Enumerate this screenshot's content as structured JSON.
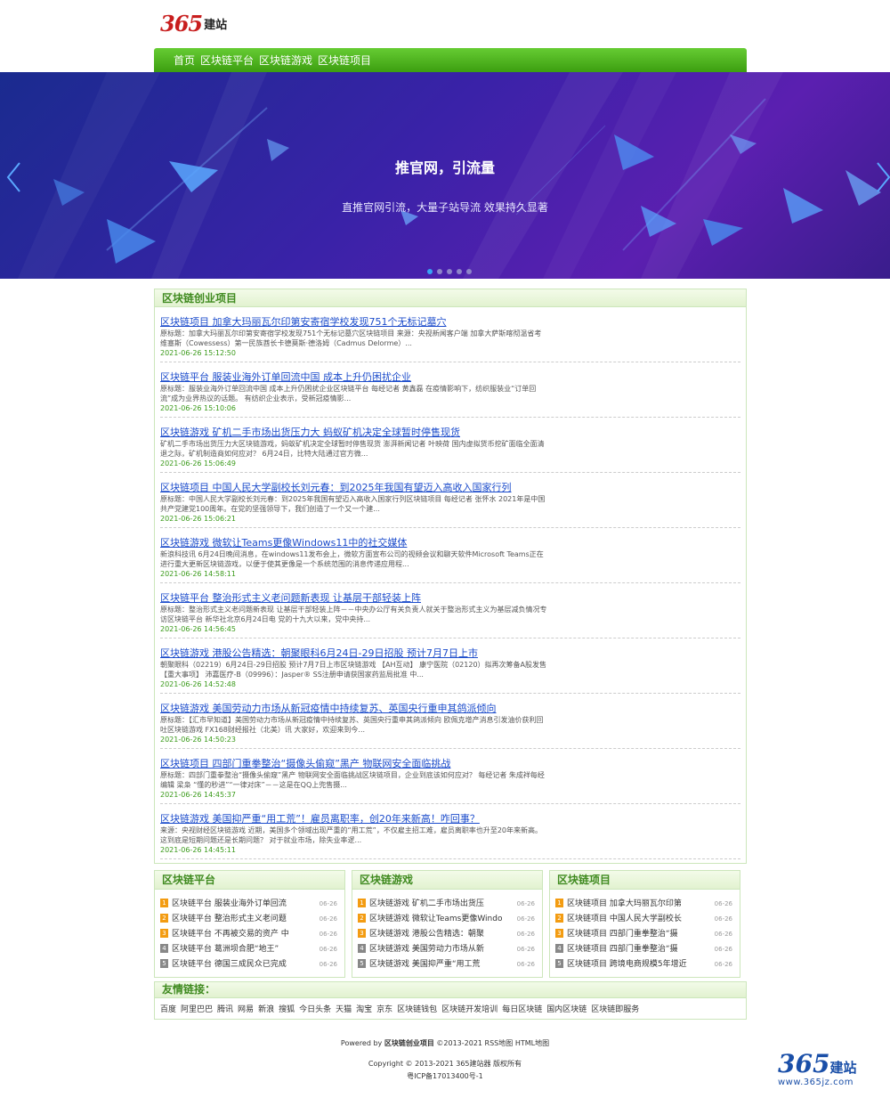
{
  "logo": {
    "number": "365",
    "text": "建站"
  },
  "nav": [
    "首页",
    "区块链平台",
    "区块链游戏",
    "区块链项目"
  ],
  "banner": {
    "title": "推官网，引流量",
    "subtitle": "直推官网引流，大量子站导流 效果持久显著",
    "slide_count": 5,
    "active_slide": 1
  },
  "main": {
    "heading": "区块链创业项目",
    "items": [
      {
        "title": "区块链项目 加拿大玛丽瓦尔印第安寄宿学校发现751个无标记墓穴",
        "desc": "原标题：加拿大玛丽瓦尔印第安寄宿学校发现751个无标记墓穴区块链项目 来源：央视新闻客户端 加拿大萨斯喀彻温省考维塞斯（Cowessess）第一民族酋长卡德莫斯·德洛姆（Cadmus Delorme）...",
        "time": "2021-06-26 15:12:50"
      },
      {
        "title": "区块链平台 服装业海外订单回流中国 成本上升仍困扰企业",
        "desc": "原标题：服装业海外订单回流中国 成本上升仍困扰企业区块链平台 每经记者 黄鑫磊 在疫情影响下，纺织服装业“订单回流”成为业界热议的话题。 有纺织企业表示，受新冠疫情影...",
        "time": "2021-06-26 15:10:06"
      },
      {
        "title": "区块链游戏 矿机二手市场出货压力大 蚂蚁矿机决定全球暂时停售现货",
        "desc": "矿机二手市场出货压力大区块链游戏，蚂蚁矿机决定全球暂时停售现货 澎湃新闻记者 叶映荷 国内虚拟货币挖矿面临全面清退之际，矿机制造商如何应对？ 6月24日，比特大陆通过官方微...",
        "time": "2021-06-26 15:06:49"
      },
      {
        "title": "区块链项目 中国人民大学副校长刘元春：到2025年我国有望迈入高收入国家行列",
        "desc": "原标题：中国人民大学副校长刘元春：到2025年我国有望迈入高收入国家行列区块链项目 每经记者 张怀水 2021年是中国共产党建党100周年。在党的坚强领导下，我们创造了一个又一个建...",
        "time": "2021-06-26 15:06:21"
      },
      {
        "title": "区块链游戏 微软让Teams更像Windows11中的社交媒体",
        "desc": "新浪科技讯 6月24日晚间消息，在windows11发布会上，微软方面宣布公司的视频会议和聊天软件Microsoft Teams正在进行重大更新区块链游戏，以便于使其更像是一个系统范围的消息传递应用程...",
        "time": "2021-06-26 14:58:11"
      },
      {
        "title": "区块链平台 整治形式主义老问题新表现 让基层干部轻装上阵",
        "desc": "原标题：整治形式主义老问题新表现 让基层干部轻装上阵－－中央办公厅有关负责人就关于整治形式主义为基层减负情况专访区块链平台 新华社北京6月24日电 党的十九大以来，党中央持...",
        "time": "2021-06-26 14:56:45"
      },
      {
        "title": "区块链游戏 港股公告精选：朝聚眼科6月24日-29日招股 预计7月7日上市",
        "desc": "朝聚眼科（02219）6月24日-29日招股 预计7月7日上市区块链游戏 【AH互动】 康宁医院（02120）拟再次筹备A股发售【重大事项】 沛嘉医疗-B（09996）：Jasper® SS注册申请获国家药监局批准 中...",
        "time": "2021-06-26 14:52:48"
      },
      {
        "title": "区块链游戏 美国劳动力市场从新冠疫情中持续复苏、英国央行重申其鸽派倾向",
        "desc": "原标题：【汇市早知道】美国劳动力市场从新冠疫情中持续复苏、英国央行重申其鸽派倾向 欧佩克增产消息引发油价获利回吐区块链游戏 FX168财经报社（北美）讯 大家好，欢迎来到今...",
        "time": "2021-06-26 14:50:23"
      },
      {
        "title": "区块链项目 四部门重拳整治“摄像头偷窥”黑产 物联网安全面临挑战",
        "desc": "原标题：四部门重拳整治“摄像头偷窥”黑产 物联网安全面临挑战区块链项目，企业到底该如何应对？ 每经记者 朱成祥每经编辑 梁枭 “懂的秒进”“一律对床”－－这是在QQ上兜售摄...",
        "time": "2021-06-26 14:45:37"
      },
      {
        "title": "区块链游戏 美国抑严重“用工荒”！雇员离职率，创20年来新高！咋回事？",
        "desc": "来源：央视财经区块链游戏 近期，美国多个领域出现严重的“用工荒”，不仅雇主招工难，雇员离职率也升至20年来新高。这到底是短期问题还是长期问题？ 对于就业市场，除失业率逻...",
        "time": "2021-06-26 14:45:11"
      }
    ]
  },
  "columns": [
    {
      "heading": "区块链平台",
      "items": [
        {
          "n": "1",
          "text": "区块链平台 服装业海外订单回流",
          "date": "06-26"
        },
        {
          "n": "2",
          "text": "区块链平台 整治形式主义老问题",
          "date": "06-26"
        },
        {
          "n": "3",
          "text": "区块链平台 不再被交易的资产 中",
          "date": "06-26"
        },
        {
          "n": "4",
          "text": "区块链平台 葛洲坝合肥“地王”",
          "date": "06-26"
        },
        {
          "n": "5",
          "text": "区块链平台 德国三成民众已完成",
          "date": "06-26"
        }
      ]
    },
    {
      "heading": "区块链游戏",
      "items": [
        {
          "n": "1",
          "text": "区块链游戏 矿机二手市场出货压",
          "date": "06-26"
        },
        {
          "n": "2",
          "text": "区块链游戏 微软让Teams更像Windo",
          "date": "06-26"
        },
        {
          "n": "3",
          "text": "区块链游戏 港股公告精选：朝聚",
          "date": "06-26"
        },
        {
          "n": "4",
          "text": "区块链游戏 美国劳动力市场从新",
          "date": "06-26"
        },
        {
          "n": "5",
          "text": "区块链游戏 美国抑严重“用工荒",
          "date": "06-26"
        }
      ]
    },
    {
      "heading": "区块链项目",
      "items": [
        {
          "n": "1",
          "text": "区块链项目 加拿大玛丽瓦尔印第",
          "date": "06-26"
        },
        {
          "n": "2",
          "text": "区块链项目 中国人民大学副校长",
          "date": "06-26"
        },
        {
          "n": "3",
          "text": "区块链项目 四部门重拳整治“摄",
          "date": "06-26"
        },
        {
          "n": "4",
          "text": "区块链项目 四部门重拳整治“摄",
          "date": "06-26"
        },
        {
          "n": "5",
          "text": "区块链项目 跨境电商规模5年增近",
          "date": "06-26"
        }
      ]
    }
  ],
  "friends": {
    "heading": "友情链接：",
    "links": [
      "百度",
      "阿里巴巴",
      "腾讯",
      "网易",
      "新浪",
      "搜狐",
      "今日头条",
      "天猫",
      "淘宝",
      "京东",
      "区块链钱包",
      "区块链开发培训",
      "每日区块链",
      "国内区块链",
      "区块链即服务"
    ]
  },
  "footer": {
    "powered_prefix": "Powered by",
    "site_name": "区块链创业项目",
    "copy_years": "©2013-2021",
    "rss": "RSS地图",
    "html_map": "HTML地图",
    "copyright": "Copyright © 2013-2021 365建站器 版权所有",
    "icp": "粤ICP备17013400号-1"
  },
  "corner_logo": {
    "number": "365",
    "text": "建站",
    "url": "www.365jz.com"
  },
  "colors": {
    "nav_green": "#4caf1e",
    "link_blue": "#1c4ccb",
    "time_green": "#3a9a1a",
    "num_badge": [
      "#f39c12",
      "#f39c12",
      "#f39c12",
      "#888888",
      "#888888"
    ]
  }
}
